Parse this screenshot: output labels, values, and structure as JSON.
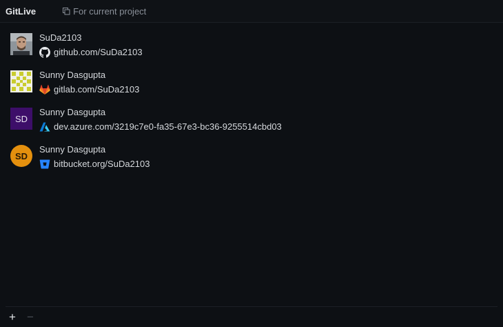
{
  "header": {
    "title": "GitLive",
    "scope_label": "For current project"
  },
  "accounts": [
    {
      "name": "SuDa2103",
      "host": "github.com/SuDa2103",
      "avatar_type": "photo",
      "host_icon": "github-icon"
    },
    {
      "name": "Sunny Dasgupta",
      "host": "gitlab.com/SuDa2103",
      "avatar_type": "identicon",
      "host_icon": "gitlab-icon"
    },
    {
      "name": "Sunny Dasgupta",
      "host": "dev.azure.com/3219c7e0-fa35-67e3-bc36-9255514cbd03",
      "avatar_type": "initials-square",
      "avatar_initials": "SD",
      "host_icon": "azure-icon"
    },
    {
      "name": "Sunny Dasgupta",
      "host": "bitbucket.org/SuDa2103",
      "avatar_type": "initials-circle",
      "avatar_initials": "SD",
      "host_icon": "bitbucket-icon"
    }
  ],
  "footer": {
    "add_label": "+",
    "remove_label": "−"
  },
  "colors": {
    "background": "#0d1014",
    "azure_avatar": "#3d0e69",
    "bitbucket_avatar": "#e4900e",
    "gitlab_orange": "#e24329",
    "azure_blue": "#0a7bd6",
    "bitbucket_blue": "#2684ff"
  }
}
